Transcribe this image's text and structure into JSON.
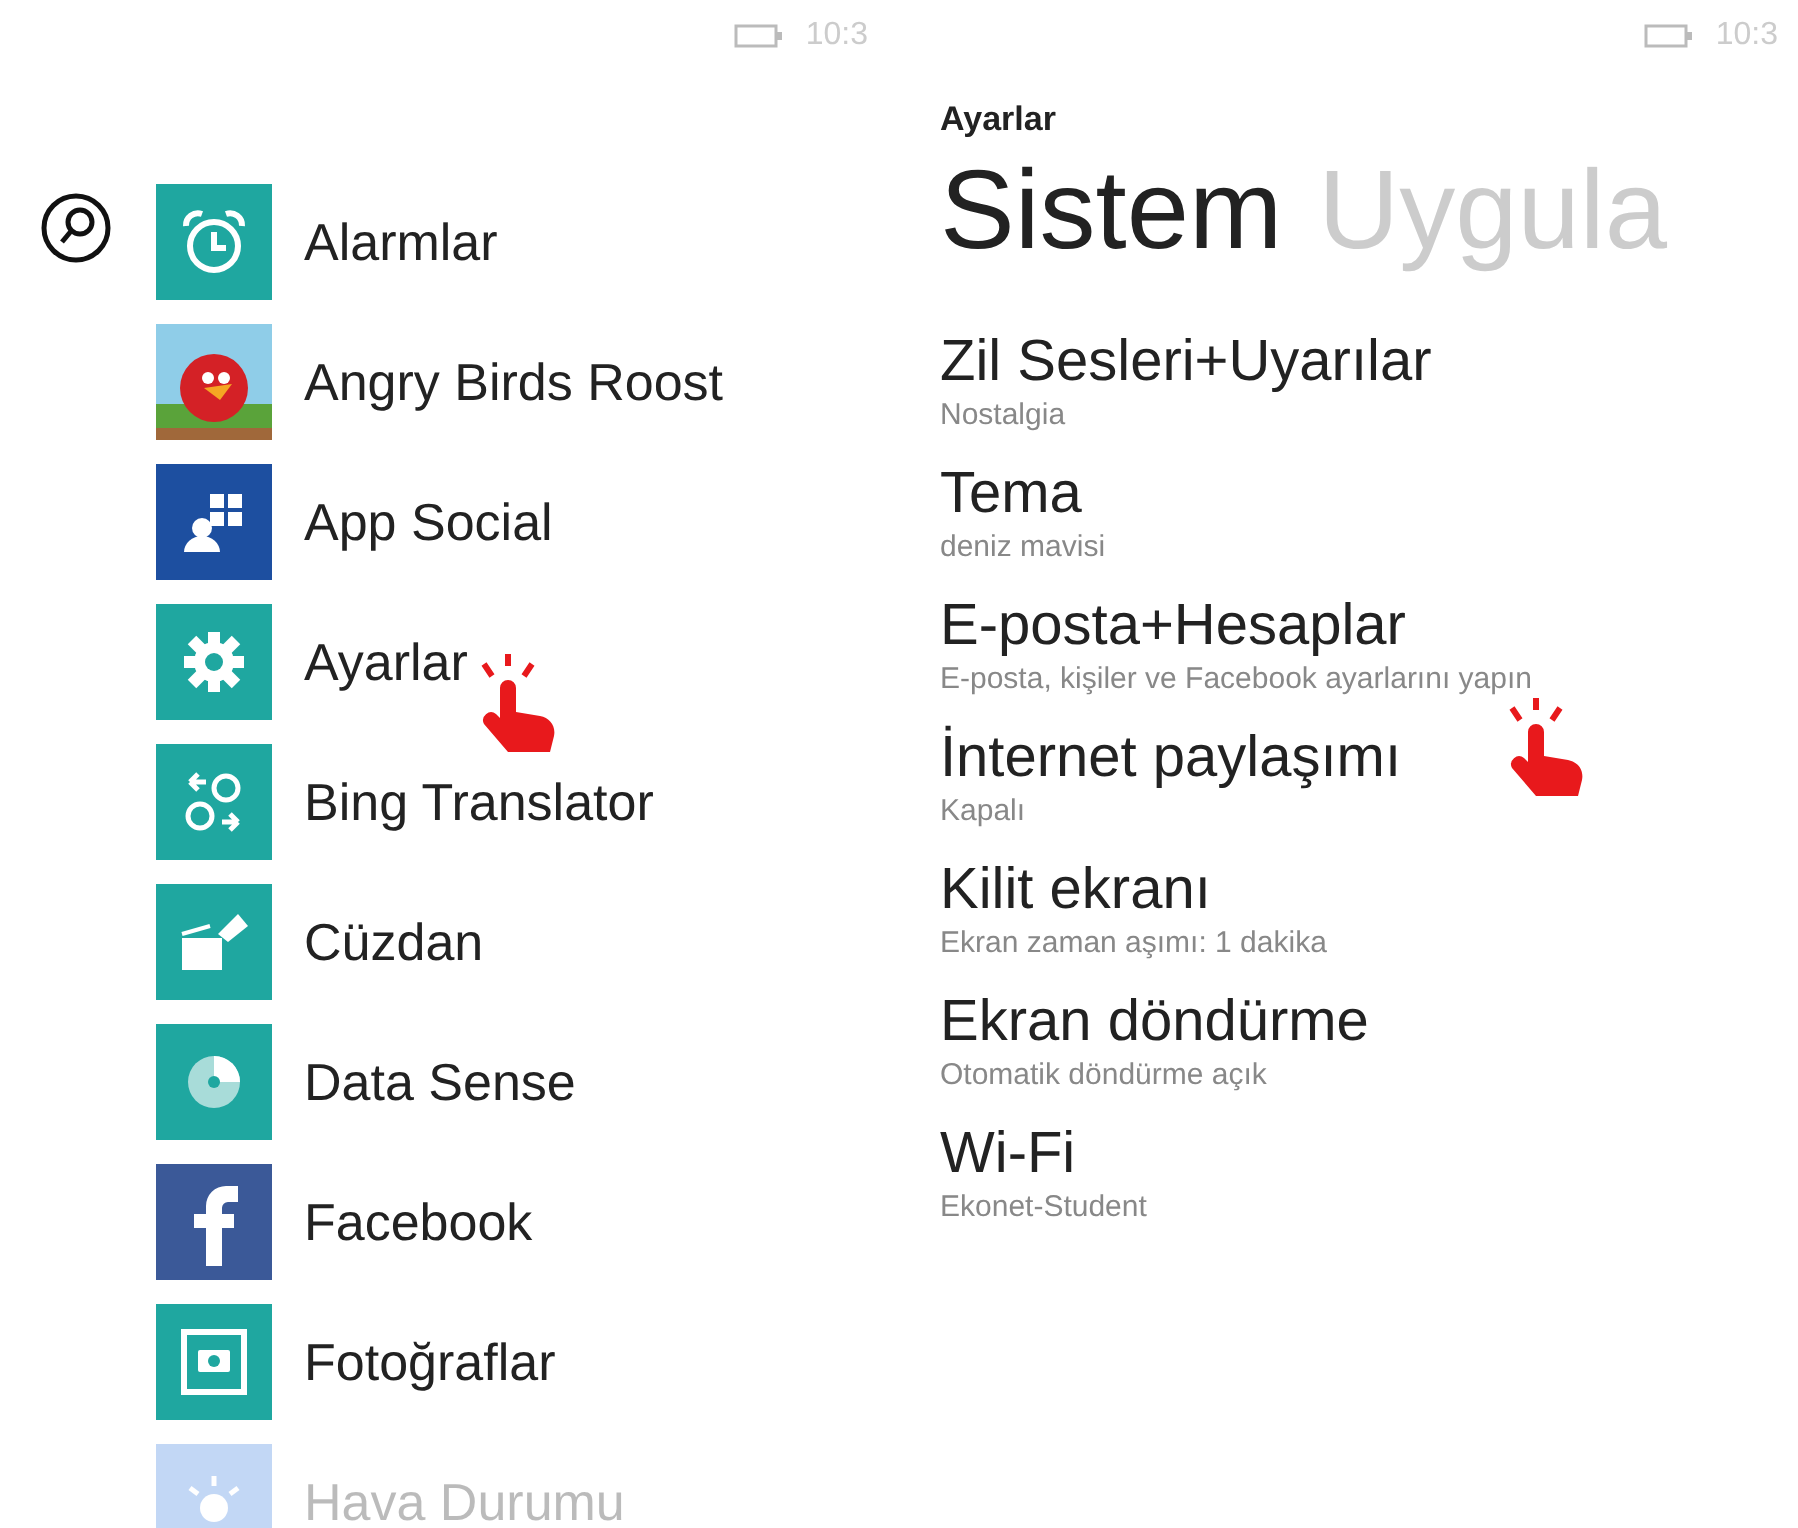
{
  "app_list": {
    "status_bar": {
      "time": "10:3"
    },
    "apps": [
      {
        "label": "Alarmlar",
        "kind": "alarm",
        "faded": false
      },
      {
        "label": "Angry Birds Roost",
        "kind": "bird",
        "faded": false
      },
      {
        "label": "App Social",
        "kind": "social",
        "faded": false
      },
      {
        "label": "Ayarlar",
        "kind": "gear",
        "faded": false
      },
      {
        "label": "Bing Translator",
        "kind": "translate",
        "faded": false
      },
      {
        "label": "Cüzdan",
        "kind": "wallet",
        "faded": false
      },
      {
        "label": "Data Sense",
        "kind": "pie",
        "faded": false
      },
      {
        "label": "Facebook",
        "kind": "facebook",
        "faded": false
      },
      {
        "label": "Fotoğraflar",
        "kind": "photo",
        "faded": false
      },
      {
        "label": "Hava Durumu",
        "kind": "weather",
        "faded": true
      }
    ]
  },
  "settings": {
    "status_bar": {
      "time": "10:3"
    },
    "app_title": "Ayarlar",
    "pivots": [
      {
        "label": "Sistem",
        "selected": true
      },
      {
        "label": "Uygula",
        "selected": false
      }
    ],
    "items": [
      {
        "title": "Zil Sesleri+Uyarılar",
        "subtitle": "Nostalgia"
      },
      {
        "title": "Tema",
        "subtitle": "deniz mavisi"
      },
      {
        "title": "E-posta+Hesaplar",
        "subtitle": "E-posta, kişiler ve Facebook ayarlarını yapın"
      },
      {
        "title": "İnternet paylaşımı",
        "subtitle": "Kapalı"
      },
      {
        "title": "Kilit ekranı",
        "subtitle": "Ekran zaman aşımı: 1 dakika"
      },
      {
        "title": "Ekran döndürme",
        "subtitle": "Otomatik döndürme açık"
      },
      {
        "title": "Wi-Fi",
        "subtitle": "Ekonet-Student"
      }
    ]
  }
}
